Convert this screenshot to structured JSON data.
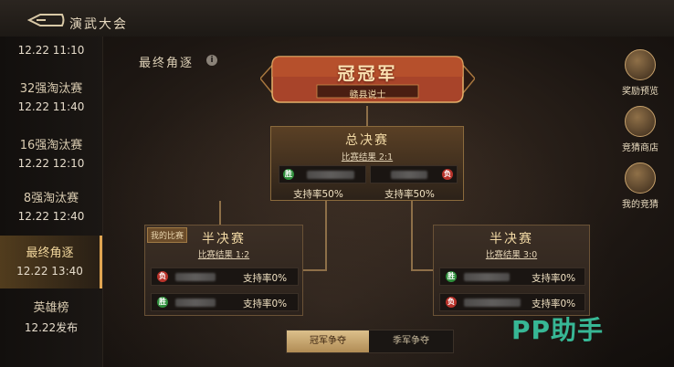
{
  "header": {
    "title": "演武大会"
  },
  "sidebar": {
    "items": [
      {
        "name": "",
        "time": "12.22 11:10",
        "active": false
      },
      {
        "name": "32强淘汰赛",
        "time": "12.22 11:40",
        "active": false
      },
      {
        "name": "16强淘汰赛",
        "time": "12.22 12:10",
        "active": false
      },
      {
        "name": "8强淘汰赛",
        "time": "12.22 12:40",
        "active": false
      },
      {
        "name": "最终角逐",
        "time": "12.22 13:40",
        "active": true
      },
      {
        "name": "英雄榜",
        "time": "12.22发布",
        "active": false
      }
    ]
  },
  "main": {
    "section_title": "最终角逐",
    "info_icon": "i",
    "champion": {
      "title": "冠冠军",
      "name": "赣县说士"
    },
    "final": {
      "title": "总决赛",
      "result": "比赛结果 2:1",
      "left": {
        "badge": "胜",
        "support": "支持率50%"
      },
      "right": {
        "badge": "负",
        "support": "支持率50%"
      }
    },
    "semi_left": {
      "tag": "我的比赛",
      "title": "半决赛",
      "result": "比赛结果 1:2",
      "top": {
        "badge": "负",
        "support": "支持率0%"
      },
      "bottom": {
        "badge": "胜",
        "support": "支持率0%"
      }
    },
    "semi_right": {
      "title": "半决赛",
      "result": "比赛结果 3:0",
      "top": {
        "badge": "胜",
        "support": "支持率0%"
      },
      "bottom": {
        "badge": "负",
        "support": "支持率0%"
      }
    },
    "tabs": {
      "active": "冠军争夺",
      "inactive": "季军争夺"
    }
  },
  "right_buttons": {
    "reward": "奖励预览",
    "shop": "竞猜商店",
    "my_guess": "我的竞猜"
  },
  "watermark": "PP助手",
  "colors": {
    "accent": "#e0a552",
    "win": "#2f8f3c",
    "lose": "#b8332b",
    "watermark": "#37b795"
  }
}
